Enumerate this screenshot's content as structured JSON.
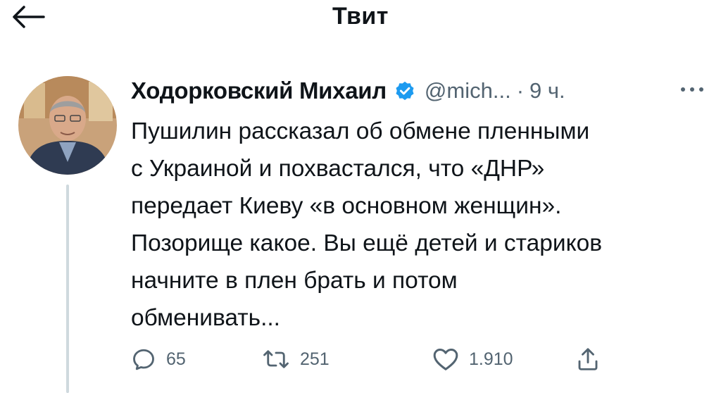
{
  "header": {
    "title": "Твит",
    "back_icon": "arrow-left-icon"
  },
  "tweet": {
    "author_name": "Ходорковский Михаил",
    "verified": true,
    "handle": "@mich...",
    "separator": "·",
    "time": "9 ч.",
    "more_icon": "more-dots-icon",
    "text_lines": [
      "Пушилин рассказал об обмене пленными",
      "с Украиной и похвастался, что «ДНР»",
      "передает Киеву «в основном женщин».",
      "Позорище какое. Вы ещё детей и стариков",
      "начните в плен брать и потом",
      "обменивать..."
    ],
    "actions": {
      "reply_count": "65",
      "retweet_count": "251",
      "like_count": "1.910"
    }
  },
  "colors": {
    "text": "#0f1419",
    "secondary": "#536471",
    "verified": "#1d9bf0",
    "thread_line": "#cfd9de"
  }
}
